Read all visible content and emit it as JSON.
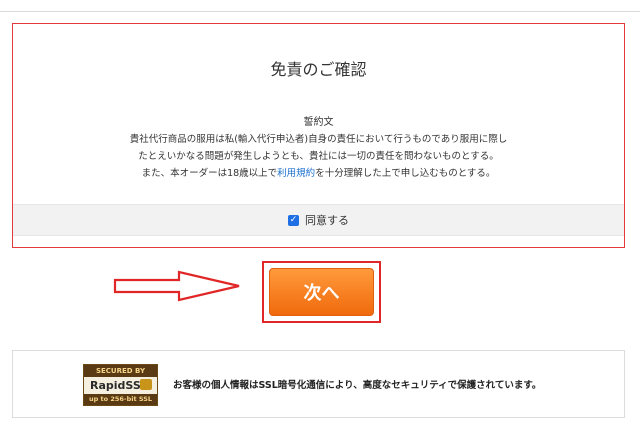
{
  "disclaimer": {
    "title": "免責のご確認",
    "terms_heading": "誓約文",
    "line1": "貴社代行商品の服用は私(輸入代行申込者)自身の責任において行うものであり服用に際し",
    "line2": "たとえいかなる問題が発生しようとも、貴社には一切の責任を問わないものとする。",
    "line3_before": "また、本オーダーは18歳以上で",
    "line3_link": "利用規約",
    "line3_after": "を十分理解した上で申し込むものとする。",
    "agree_label": "同意する",
    "agree_checked": true
  },
  "next_button": {
    "label": "次へ"
  },
  "ssl": {
    "badge_top": "SECURED BY",
    "badge_brand": "RapidSSL",
    "badge_bottom": "up to 256-bit SSL",
    "message": "お客様の個人情報はSSL暗号化通信により、高度なセキュリティで保護されています。"
  },
  "colors": {
    "panel_border": "#e23a3a",
    "button_orange": "#f07a1c",
    "link_blue": "#1a6fd0",
    "checkbox_blue": "#1f6fe5"
  }
}
